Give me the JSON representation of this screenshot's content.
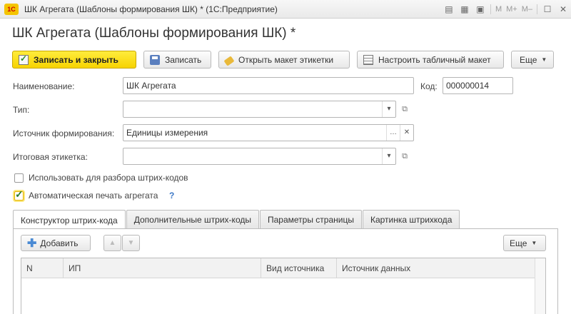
{
  "window": {
    "title": "ШК Агрегата (Шаблоны формирования ШК) * (1С:Предприятие)",
    "logo": "1С",
    "buttons": {
      "m": "M",
      "mplus": "M+",
      "mminus": "M–"
    }
  },
  "heading": "ШК Агрегата (Шаблоны формирования ШК) *",
  "toolbar": {
    "save_close": "Записать и закрыть",
    "save": "Записать",
    "open_label": "Открыть макет этикетки",
    "config_table": "Настроить табличный макет",
    "more": "Еще"
  },
  "form": {
    "name_label": "Наименование:",
    "name_value": "ШК Агрегата",
    "code_label": "Код:",
    "code_value": "000000014",
    "type_label": "Тип:",
    "type_value": "",
    "source_label": "Источник формирования:",
    "source_value": "Единицы измерения",
    "final_label_label": "Итоговая этикетка:",
    "final_label_value": "",
    "use_parse_label": "Использовать для разбора штрих-кодов",
    "use_parse_checked": false,
    "auto_print_label": "Автоматическая печать агрегата",
    "auto_print_checked": true,
    "help": "?"
  },
  "tabs": [
    {
      "label": "Конструктор штрих-кода",
      "active": true
    },
    {
      "label": "Дополнительные штрих-коды",
      "active": false
    },
    {
      "label": "Параметры страницы",
      "active": false
    },
    {
      "label": "Картинка штрихкода",
      "active": false
    }
  ],
  "panel": {
    "add": "Добавить",
    "more": "Еще",
    "columns": [
      "N",
      "ИП",
      "Вид источника",
      "Источник данных"
    ]
  },
  "colors": {
    "primary": "#f7d300",
    "accent": "#3c78c6",
    "border": "#b5b5b5"
  },
  "icons": [
    "save-close-icon",
    "save-icon",
    "tag-icon",
    "table-icon",
    "plus-icon",
    "arrow-up-icon",
    "arrow-down-icon"
  ]
}
